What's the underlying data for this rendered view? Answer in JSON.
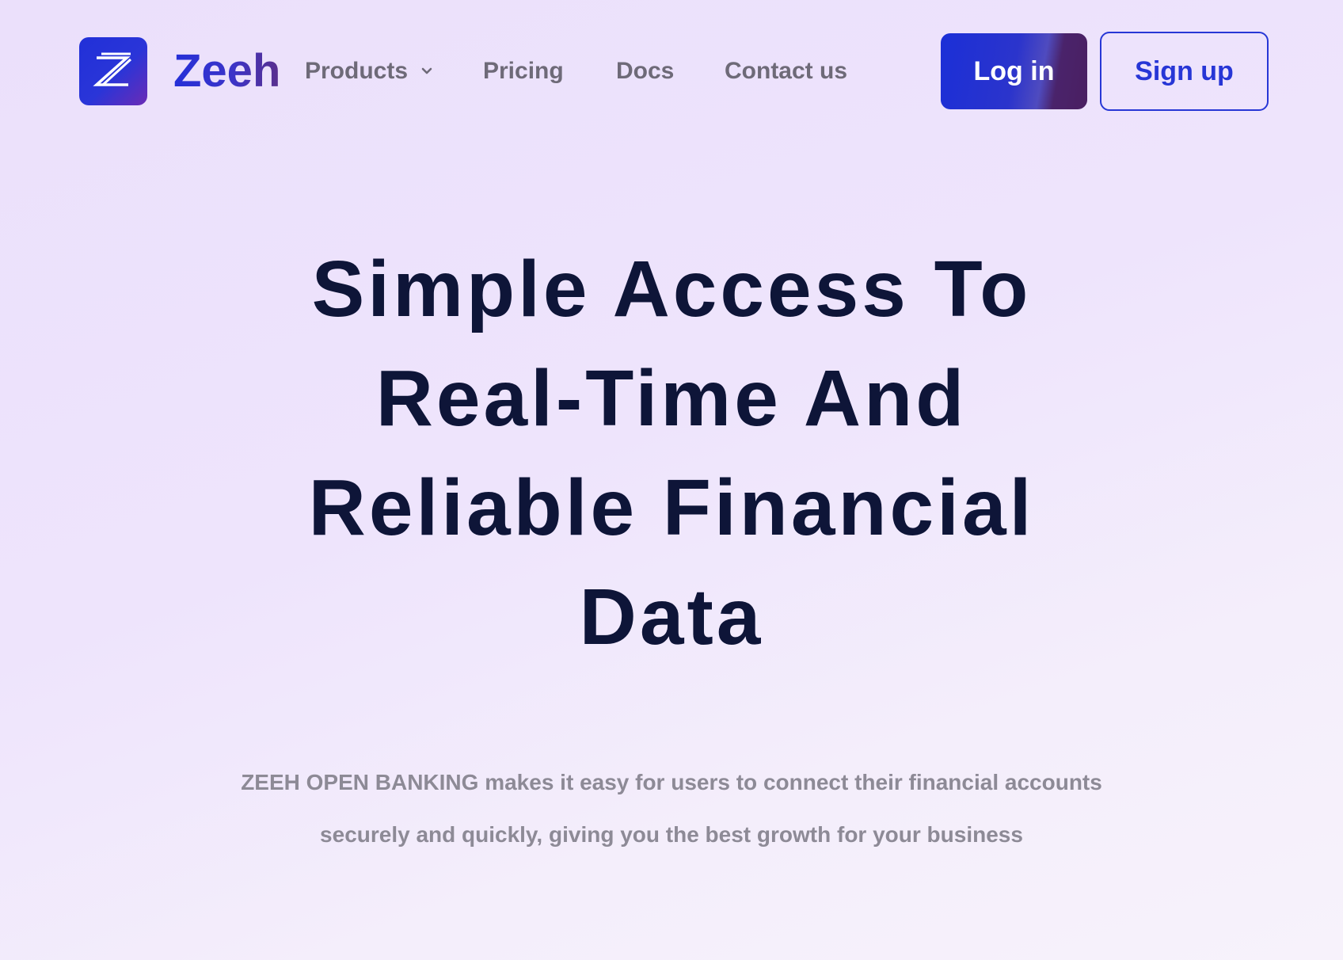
{
  "header": {
    "brand": {
      "logo_icon": "z-logo-icon",
      "name": "Zeeh"
    },
    "nav": {
      "products": "Products",
      "products_icon": "chevron-down-icon",
      "pricing": "Pricing",
      "docs": "Docs",
      "contact": "Contact us"
    },
    "actions": {
      "login": "Log in",
      "signup": "Sign up"
    }
  },
  "hero": {
    "title": "Simple Access To Real-Time And Reliable Financial Data",
    "subtitle": "ZEEH OPEN BANKING makes it easy for users to connect their financial accounts securely and quickly, giving you the best growth for your business"
  },
  "colors": {
    "brand_blue": "#2130d8",
    "brand_purple": "#4a1f61",
    "heading": "#0e1538",
    "nav_text": "#6e6a78",
    "subtitle_text": "#8d8a96",
    "background": "#ece2fb"
  }
}
